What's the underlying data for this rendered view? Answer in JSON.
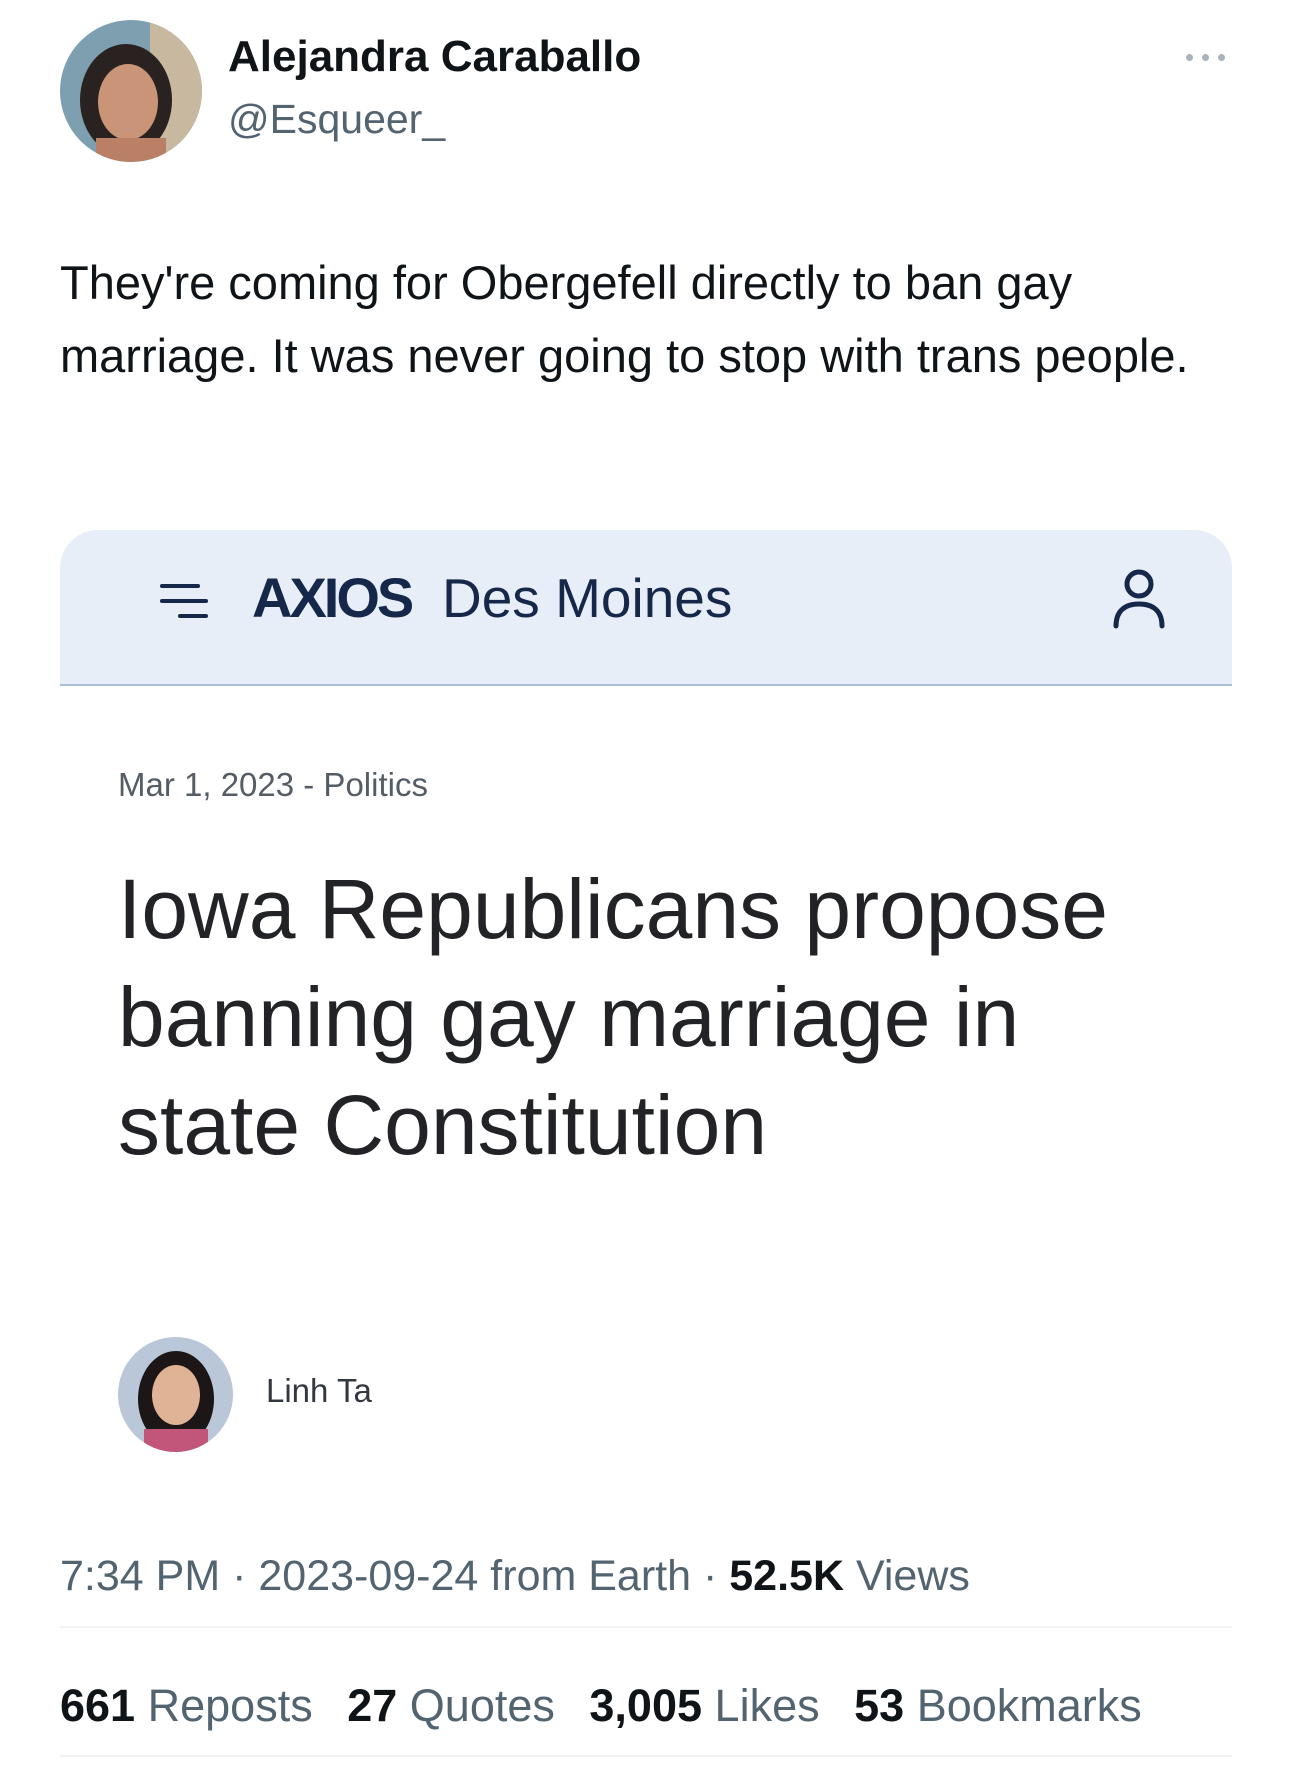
{
  "tweet": {
    "author_name": "Alejandra Caraballo",
    "author_handle": "@Esqueer_",
    "text": "They're coming for Obergefell directly to ban gay marriage. It was never going to stop with trans people.",
    "more_icon": "more-horizontal-icon"
  },
  "card": {
    "menu_icon": "hamburger-menu-icon",
    "logo": "AXIOS",
    "section": "Des Moines",
    "user_icon": "user-profile-icon",
    "meta": "Mar 1, 2023 - Politics",
    "headline": "Iowa Republicans propose banning gay marriage in state Constitution",
    "author": "Linh Ta",
    "header_bg": "#e7eef8",
    "brand_color": "#15284a"
  },
  "timestamp": {
    "time": "7:34 PM",
    "date": "2023-09-24",
    "source": "from Earth",
    "views_count": "52.5K",
    "views_label": "Views"
  },
  "stats": {
    "reposts_count": "661",
    "reposts_label": "Reposts",
    "quotes_count": "27",
    "quotes_label": "Quotes",
    "likes_count": "3,005",
    "likes_label": "Likes",
    "bookmarks_count": "53",
    "bookmarks_label": "Bookmarks"
  }
}
